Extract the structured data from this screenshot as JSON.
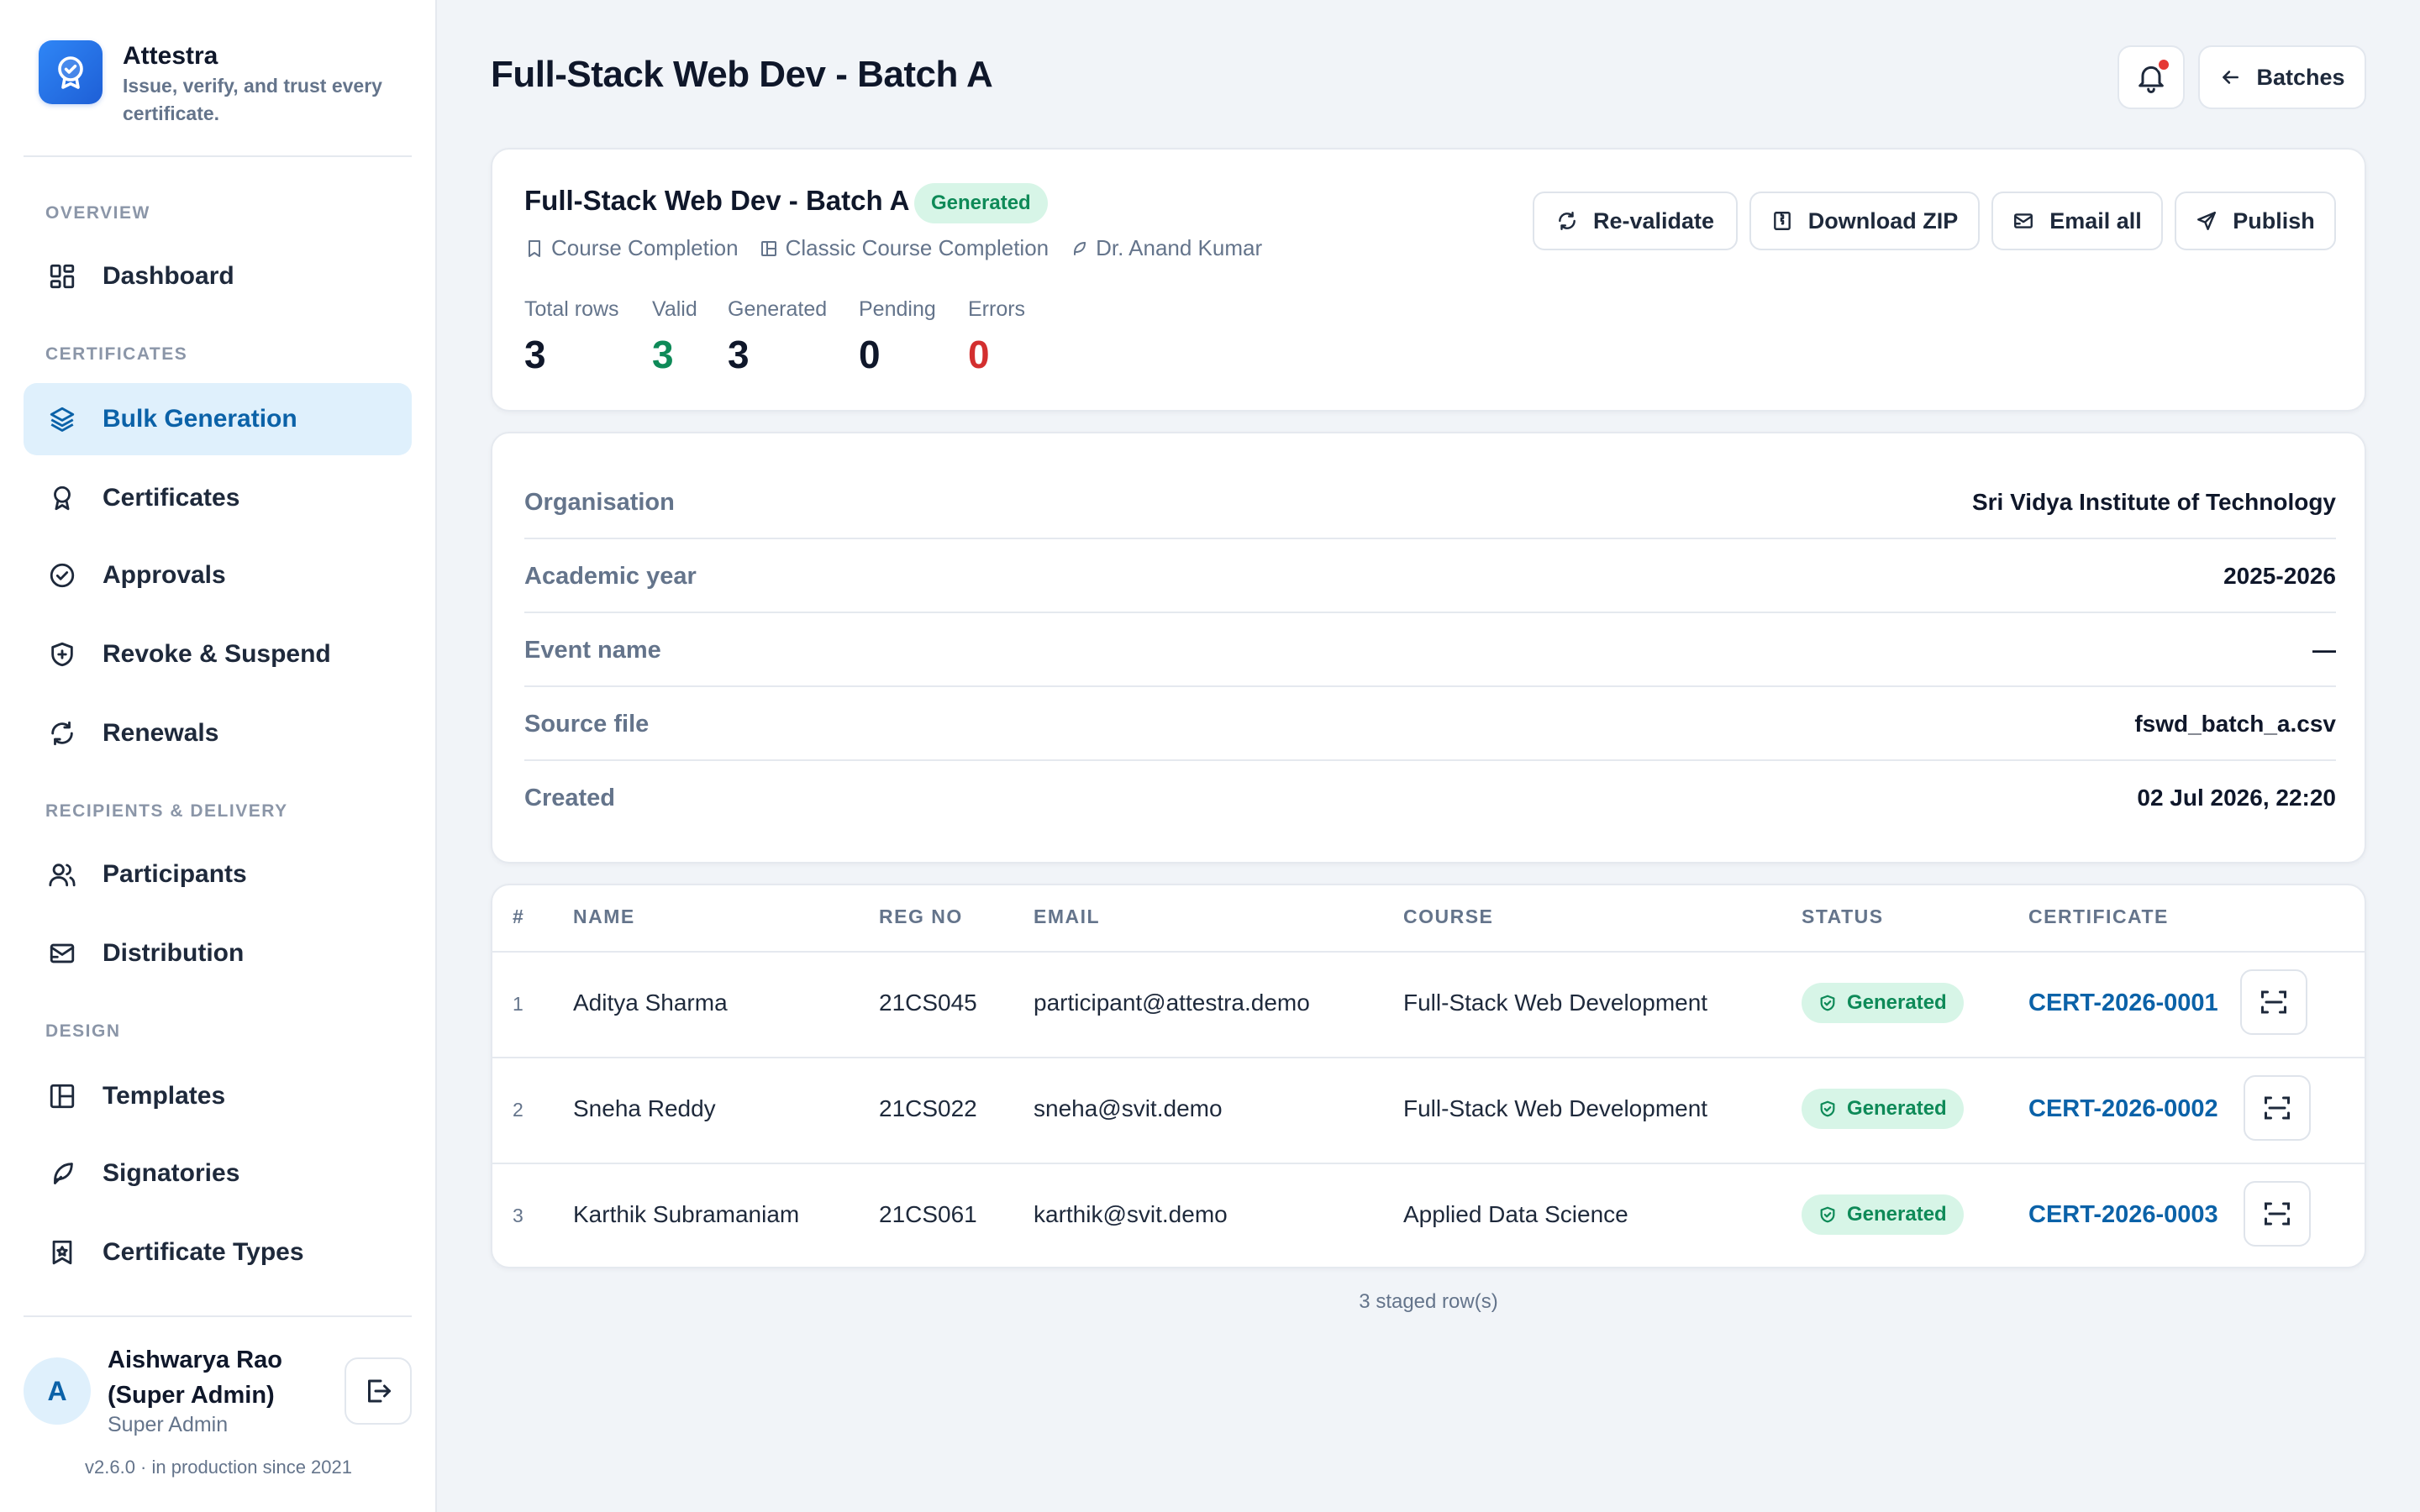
{
  "brand": {
    "name": "Attestra",
    "tagline": "Issue, verify, and trust every certificate."
  },
  "nav": {
    "sections": {
      "overview": "OVERVIEW",
      "certificates": "CERTIFICATES",
      "recipients": "RECIPIENTS & DELIVERY",
      "design": "DESIGN"
    },
    "items": {
      "dashboard": "Dashboard",
      "bulk_generation": "Bulk Generation",
      "certificates": "Certificates",
      "approvals": "Approvals",
      "revoke": "Revoke & Suspend",
      "renewals": "Renewals",
      "participants": "Participants",
      "distribution": "Distribution",
      "templates": "Templates",
      "signatories": "Signatories",
      "certificate_types": "Certificate Types"
    },
    "active": "bulk_generation"
  },
  "user": {
    "initial": "A",
    "name": "Aishwarya Rao (Super Admin)",
    "role": "Super Admin"
  },
  "version": "v2.6.0 · in production since 2021",
  "header": {
    "title": "Full-Stack Web Dev - Batch A",
    "back_label": "Batches"
  },
  "batch": {
    "title": "Full-Stack Web Dev - Batch A",
    "status": "Generated",
    "certificate_type": "Course Completion",
    "template": "Classic Course Completion",
    "signatory": "Dr. Anand Kumar",
    "stats": {
      "total": {
        "label": "Total rows",
        "value": "3"
      },
      "valid": {
        "label": "Valid",
        "value": "3"
      },
      "generated": {
        "label": "Generated",
        "value": "3"
      },
      "pending": {
        "label": "Pending",
        "value": "0"
      },
      "errors": {
        "label": "Errors",
        "value": "0"
      }
    },
    "actions": {
      "revalidate": "Re-validate",
      "download_zip": "Download ZIP",
      "email_all": "Email all",
      "publish": "Publish"
    }
  },
  "details": [
    {
      "label": "Organisation",
      "value": "Sri Vidya Institute of Technology"
    },
    {
      "label": "Academic year",
      "value": "2025-2026"
    },
    {
      "label": "Event name",
      "value": "—"
    },
    {
      "label": "Source file",
      "value": "fswd_batch_a.csv"
    },
    {
      "label": "Created",
      "value": "02 Jul 2026, 22:20"
    }
  ],
  "table": {
    "columns": [
      "#",
      "NAME",
      "REG NO",
      "EMAIL",
      "COURSE",
      "STATUS",
      "CERTIFICATE"
    ],
    "rows": [
      {
        "num": "1",
        "name": "Aditya Sharma",
        "reg": "21CS045",
        "email": "participant@attestra.demo",
        "course": "Full-Stack Web Development",
        "status": "Generated",
        "cert": "CERT-2026-0001"
      },
      {
        "num": "2",
        "name": "Sneha Reddy",
        "reg": "21CS022",
        "email": "sneha@svit.demo",
        "course": "Full-Stack Web Development",
        "status": "Generated",
        "cert": "CERT-2026-0002"
      },
      {
        "num": "3",
        "name": "Karthik Subramaniam",
        "reg": "21CS061",
        "email": "karthik@svit.demo",
        "course": "Applied Data Science",
        "status": "Generated",
        "cert": "CERT-2026-0003"
      }
    ],
    "footer": "3 staged row(s)"
  },
  "colors": {
    "accent": "#0b62a8",
    "success": "#0e8a58",
    "error": "#d32f2f",
    "active_bg": "#dff0fc"
  }
}
